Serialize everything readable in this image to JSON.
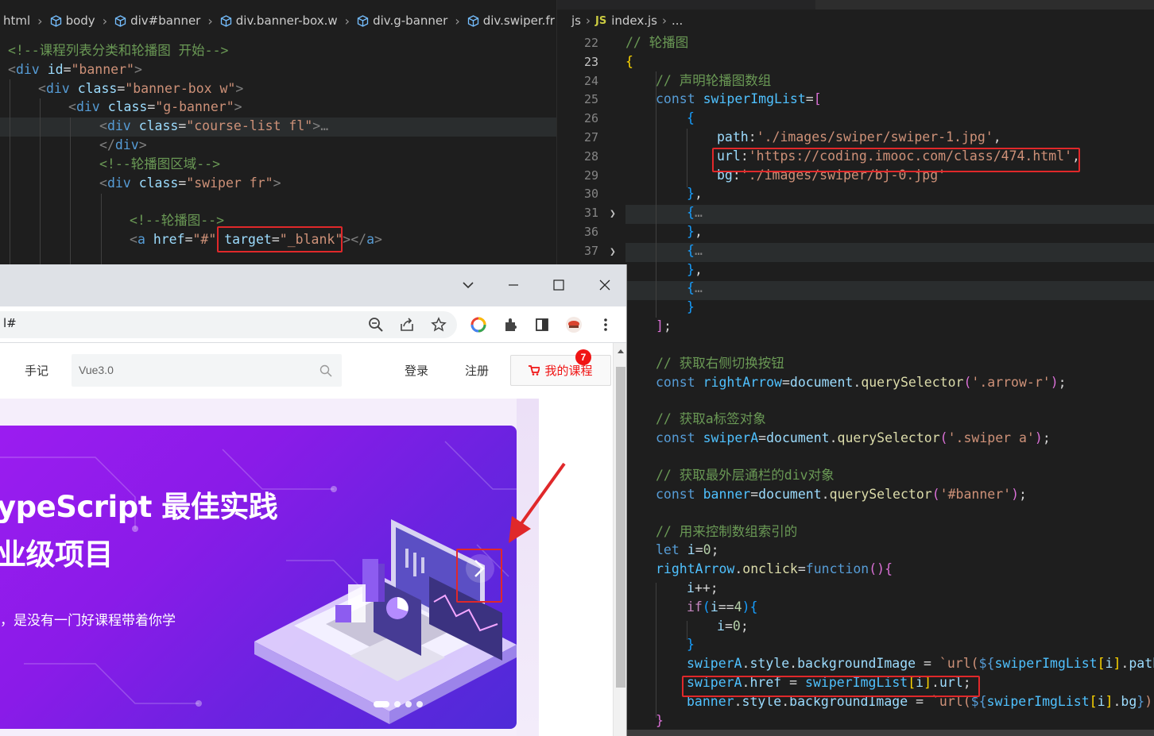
{
  "left_editor": {
    "breadcrumb": [
      "html",
      "body",
      "div#banner",
      "div.banner-box.w",
      "div.g-banner",
      "div.swiper.fr"
    ],
    "lines": [
      {
        "tokens": [
          [
            "c-com",
            "<!--课程列表分类和轮播图 开始-->"
          ]
        ]
      },
      {
        "tokens": [
          [
            "c-punc",
            "<"
          ],
          [
            "c-tag",
            "div"
          ],
          [
            "c-txt",
            " "
          ],
          [
            "c-attr",
            "id"
          ],
          [
            "c-txt",
            "="
          ],
          [
            "c-str",
            "\"banner\""
          ],
          [
            "c-punc",
            ">"
          ]
        ]
      },
      {
        "tokens": [
          [
            "c-punc",
            "<"
          ],
          [
            "c-tag",
            "div"
          ],
          [
            "c-txt",
            " "
          ],
          [
            "c-attr",
            "class"
          ],
          [
            "c-txt",
            "="
          ],
          [
            "c-str",
            "\"banner-box w\""
          ],
          [
            "c-punc",
            ">"
          ]
        ]
      },
      {
        "tokens": [
          [
            "c-punc",
            "<"
          ],
          [
            "c-tag",
            "div"
          ],
          [
            "c-txt",
            " "
          ],
          [
            "c-attr",
            "class"
          ],
          [
            "c-txt",
            "="
          ],
          [
            "c-str",
            "\"g-banner\""
          ],
          [
            "c-punc",
            ">"
          ]
        ]
      },
      {
        "tokens": [
          [
            "c-punc",
            "<"
          ],
          [
            "c-tag",
            "div"
          ],
          [
            "c-txt",
            " "
          ],
          [
            "c-attr",
            "class"
          ],
          [
            "c-txt",
            "="
          ],
          [
            "c-str",
            "\"course-list fl\""
          ],
          [
            "c-punc",
            ">"
          ],
          [
            "c-punc",
            "…"
          ]
        ]
      },
      {
        "tokens": [
          [
            "c-punc",
            "</"
          ],
          [
            "c-tag",
            "div"
          ],
          [
            "c-punc",
            ">"
          ]
        ]
      },
      {
        "tokens": [
          [
            "c-com",
            "<!--轮播图区域-->"
          ]
        ]
      },
      {
        "tokens": [
          [
            "c-punc",
            "<"
          ],
          [
            "c-tag",
            "div"
          ],
          [
            "c-txt",
            " "
          ],
          [
            "c-attr",
            "class"
          ],
          [
            "c-txt",
            "="
          ],
          [
            "c-str",
            "\"swiper fr\""
          ],
          [
            "c-punc",
            ">"
          ]
        ]
      },
      {
        "tokens": []
      },
      {
        "tokens": [
          [
            "c-com",
            "<!--轮播图-->"
          ]
        ]
      },
      {
        "tokens": [
          [
            "c-punc",
            "<"
          ],
          [
            "c-tag",
            "a"
          ],
          [
            "c-txt",
            " "
          ],
          [
            "c-attr",
            "href"
          ],
          [
            "c-txt",
            "="
          ],
          [
            "c-str",
            "\"#\""
          ],
          [
            "c-txt",
            " "
          ],
          [
            "c-attr",
            "target"
          ],
          [
            "c-txt",
            "="
          ],
          [
            "c-str",
            "\"_blank\""
          ],
          [
            "c-punc",
            "></"
          ],
          [
            "c-tag",
            "a"
          ],
          [
            "c-punc",
            ">"
          ]
        ]
      }
    ]
  },
  "right_editor": {
    "breadcrumb": {
      "folder": "js",
      "badge": "JS",
      "file": "index.js",
      "more": "..."
    },
    "lines": [
      {
        "n": "22",
        "tokens": [
          [
            "c-com",
            "// 轮播图"
          ]
        ]
      },
      {
        "n": "23",
        "tokens": [
          [
            "c-br1",
            "{"
          ]
        ]
      },
      {
        "n": "24",
        "tokens": [
          [
            "c-com",
            "// 声明轮播图数组"
          ]
        ]
      },
      {
        "n": "25",
        "tokens": [
          [
            "c-kw",
            "const"
          ],
          [
            "c-txt",
            " "
          ],
          [
            "c-var",
            "swiperImgList"
          ],
          [
            "c-txt",
            "="
          ],
          [
            "c-br2",
            "["
          ]
        ]
      },
      {
        "n": "26",
        "tokens": [
          [
            "c-br3",
            "{"
          ]
        ]
      },
      {
        "n": "27",
        "tokens": [
          [
            "c-prop",
            "path"
          ],
          [
            "c-txt",
            ":"
          ],
          [
            "c-str",
            "'./images/swiper/swiper-1.jpg'"
          ],
          [
            "c-txt",
            ","
          ]
        ]
      },
      {
        "n": "28",
        "tokens": [
          [
            "c-prop",
            "url"
          ],
          [
            "c-txt",
            ":"
          ],
          [
            "c-str",
            "'https://coding.imooc.com/class/474.html'"
          ],
          [
            "c-txt",
            ","
          ]
        ]
      },
      {
        "n": "29",
        "tokens": [
          [
            "c-prop",
            "bg"
          ],
          [
            "c-txt",
            ":"
          ],
          [
            "c-str",
            "'./images/swiper/bj-0.jpg'"
          ]
        ]
      },
      {
        "n": "30",
        "tokens": [
          [
            "c-br3",
            "}"
          ],
          [
            "c-txt",
            ","
          ]
        ]
      },
      {
        "n": "31",
        "tokens": [
          [
            "c-br3",
            "{"
          ],
          [
            "c-punc",
            "…"
          ]
        ]
      },
      {
        "n": "36",
        "tokens": [
          [
            "c-br3",
            "}"
          ],
          [
            "c-txt",
            ","
          ]
        ]
      },
      {
        "n": "37",
        "tokens": [
          [
            "c-br3",
            "{"
          ],
          [
            "c-punc",
            "…"
          ]
        ]
      },
      {
        "n": "",
        "tokens": [
          [
            "c-br3",
            "}"
          ],
          [
            "c-txt",
            ","
          ]
        ]
      },
      {
        "n": "",
        "tokens": [
          [
            "c-br3",
            "{"
          ],
          [
            "c-punc",
            "…"
          ]
        ]
      },
      {
        "n": "",
        "tokens": [
          [
            "c-br3",
            "}"
          ]
        ]
      },
      {
        "n": "",
        "tokens": [
          [
            "c-br2",
            "]"
          ],
          [
            "c-txt",
            ";"
          ]
        ]
      },
      {
        "n": "",
        "tokens": []
      },
      {
        "n": "",
        "tokens": [
          [
            "c-com",
            "// 获取右侧切换按钮"
          ]
        ]
      },
      {
        "n": "",
        "tokens": [
          [
            "c-kw",
            "const"
          ],
          [
            "c-txt",
            " "
          ],
          [
            "c-var",
            "rightArrow"
          ],
          [
            "c-txt",
            "="
          ],
          [
            "c-prop",
            "document"
          ],
          [
            "c-txt",
            "."
          ],
          [
            "c-fn",
            "querySelector"
          ],
          [
            "c-br2",
            "("
          ],
          [
            "c-str",
            "'.arrow-r'"
          ],
          [
            "c-br2",
            ")"
          ],
          [
            "c-txt",
            ";"
          ]
        ]
      },
      {
        "n": "",
        "tokens": []
      },
      {
        "n": "",
        "tokens": [
          [
            "c-com",
            "// 获取a标签对象"
          ]
        ]
      },
      {
        "n": "",
        "tokens": [
          [
            "c-kw",
            "const"
          ],
          [
            "c-txt",
            " "
          ],
          [
            "c-var",
            "swiperA"
          ],
          [
            "c-txt",
            "="
          ],
          [
            "c-prop",
            "document"
          ],
          [
            "c-txt",
            "."
          ],
          [
            "c-fn",
            "querySelector"
          ],
          [
            "c-br2",
            "("
          ],
          [
            "c-str",
            "'.swiper a'"
          ],
          [
            "c-br2",
            ")"
          ],
          [
            "c-txt",
            ";"
          ]
        ]
      },
      {
        "n": "",
        "tokens": []
      },
      {
        "n": "",
        "tokens": [
          [
            "c-com",
            "// 获取最外层通栏的div对象"
          ]
        ]
      },
      {
        "n": "",
        "tokens": [
          [
            "c-kw",
            "const"
          ],
          [
            "c-txt",
            " "
          ],
          [
            "c-var",
            "banner"
          ],
          [
            "c-txt",
            "="
          ],
          [
            "c-prop",
            "document"
          ],
          [
            "c-txt",
            "."
          ],
          [
            "c-fn",
            "querySelector"
          ],
          [
            "c-br2",
            "("
          ],
          [
            "c-str",
            "'#banner'"
          ],
          [
            "c-br2",
            ")"
          ],
          [
            "c-txt",
            ";"
          ]
        ]
      },
      {
        "n": "",
        "tokens": []
      },
      {
        "n": "",
        "tokens": [
          [
            "c-com",
            "// 用来控制数组索引的"
          ]
        ]
      },
      {
        "n": "",
        "tokens": [
          [
            "c-kw",
            "let"
          ],
          [
            "c-txt",
            " "
          ],
          [
            "c-prop",
            "i"
          ],
          [
            "c-txt",
            "="
          ],
          [
            "c-num",
            "0"
          ],
          [
            "c-txt",
            ";"
          ]
        ]
      },
      {
        "n": "",
        "tokens": [
          [
            "c-var",
            "rightArrow"
          ],
          [
            "c-txt",
            "."
          ],
          [
            "c-fn",
            "onclick"
          ],
          [
            "c-txt",
            "="
          ],
          [
            "c-kw",
            "function"
          ],
          [
            "c-br2",
            "()"
          ],
          [
            "c-br2",
            "{"
          ]
        ]
      },
      {
        "n": "",
        "tokens": [
          [
            "c-prop",
            "i"
          ],
          [
            "c-txt",
            "++;"
          ]
        ]
      },
      {
        "n": "",
        "tokens": [
          [
            "c-ctrl",
            "if"
          ],
          [
            "c-br3",
            "("
          ],
          [
            "c-prop",
            "i"
          ],
          [
            "c-txt",
            "=="
          ],
          [
            "c-num",
            "4"
          ],
          [
            "c-br3",
            ")"
          ],
          [
            "c-br3",
            "{"
          ]
        ]
      },
      {
        "n": "",
        "tokens": [
          [
            "c-prop",
            "i"
          ],
          [
            "c-txt",
            "="
          ],
          [
            "c-num",
            "0"
          ],
          [
            "c-txt",
            ";"
          ]
        ]
      },
      {
        "n": "",
        "tokens": [
          [
            "c-br3",
            "}"
          ]
        ]
      },
      {
        "n": "",
        "tokens": [
          [
            "c-var",
            "swiperA"
          ],
          [
            "c-txt",
            "."
          ],
          [
            "c-prop",
            "style"
          ],
          [
            "c-txt",
            "."
          ],
          [
            "c-prop",
            "backgroundImage"
          ],
          [
            "c-txt",
            " = "
          ],
          [
            "c-tpl",
            "`url("
          ],
          [
            "c-kw",
            "${"
          ],
          [
            "c-var",
            "swiperImgList"
          ],
          [
            "c-br1",
            "["
          ],
          [
            "c-prop",
            "i"
          ],
          [
            "c-br1",
            "]"
          ],
          [
            "c-txt",
            "."
          ],
          [
            "c-prop",
            "path"
          ],
          [
            "c-kw",
            "}"
          ]
        ]
      },
      {
        "n": "",
        "tokens": [
          [
            "c-var",
            "swiperA"
          ],
          [
            "c-txt",
            "."
          ],
          [
            "c-prop",
            "href"
          ],
          [
            "c-txt",
            " = "
          ],
          [
            "c-var",
            "swiperImgList"
          ],
          [
            "c-br1",
            "["
          ],
          [
            "c-prop",
            "i"
          ],
          [
            "c-br1",
            "]"
          ],
          [
            "c-txt",
            "."
          ],
          [
            "c-prop",
            "url"
          ],
          [
            "c-txt",
            ";"
          ]
        ]
      },
      {
        "n": "",
        "tokens": [
          [
            "c-var",
            "banner"
          ],
          [
            "c-txt",
            "."
          ],
          [
            "c-prop",
            "style"
          ],
          [
            "c-txt",
            "."
          ],
          [
            "c-prop",
            "backgroundImage"
          ],
          [
            "c-txt",
            " = "
          ],
          [
            "c-tpl",
            "`url("
          ],
          [
            "c-kw",
            "${"
          ],
          [
            "c-var",
            "swiperImgList"
          ],
          [
            "c-br1",
            "["
          ],
          [
            "c-prop",
            "i"
          ],
          [
            "c-br1",
            "]"
          ],
          [
            "c-txt",
            "."
          ],
          [
            "c-prop",
            "bg"
          ],
          [
            "c-kw",
            "}"
          ],
          [
            "c-tpl",
            ")`"
          ],
          [
            "c-txt",
            ";"
          ]
        ]
      },
      {
        "n": "",
        "tokens": [
          [
            "c-br2",
            "}"
          ]
        ]
      }
    ]
  },
  "browser": {
    "address_text": "l#",
    "nav": {
      "notes": "手记",
      "search_placeholder": "Vue3.0",
      "login": "登录",
      "register": "注册",
      "my_courses": "我的课程",
      "badge_count": "7"
    },
    "banner": {
      "title_line1": "ypeScript 最佳实践",
      "title_line2": "业级项目",
      "subtitle": "，是没有一门好课程带着你学"
    },
    "colors": {
      "accent_red": "#f01414",
      "annotation_red": "#e0282a"
    }
  }
}
